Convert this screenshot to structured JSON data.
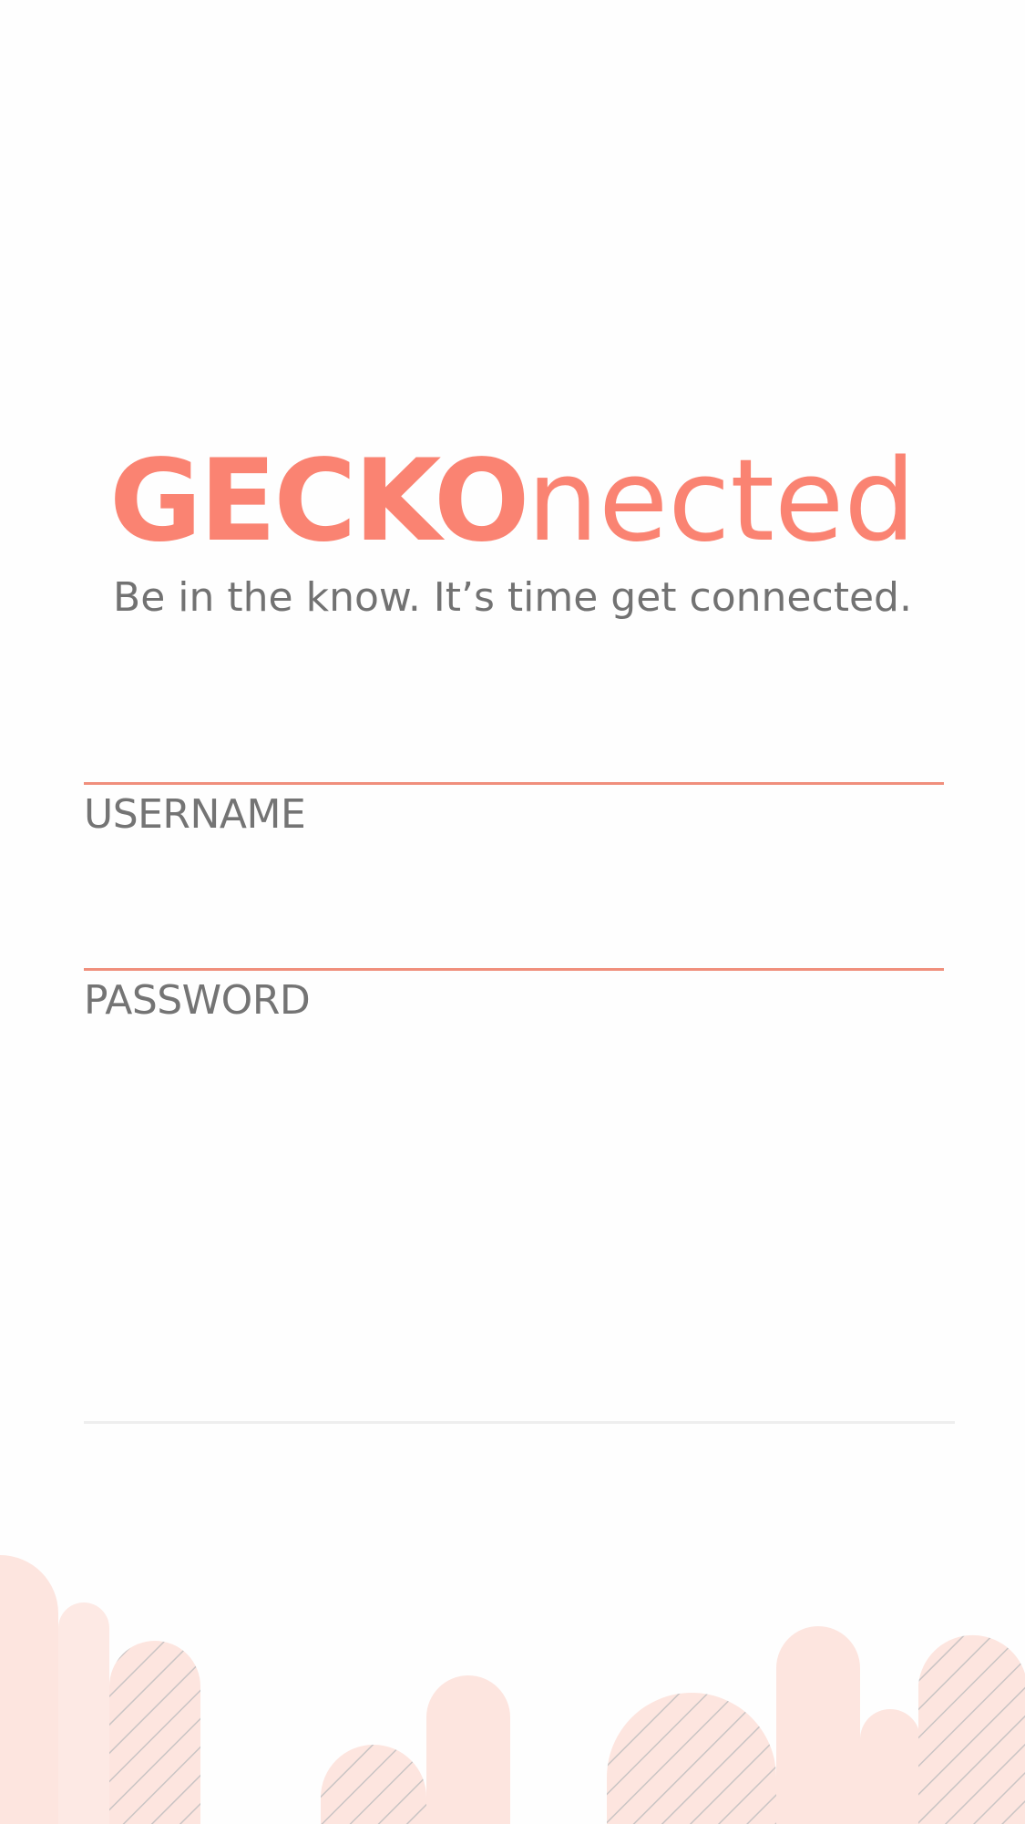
{
  "app": {
    "brand_bold": "GECKO",
    "brand_light": "nected",
    "tagline": "Be in the know. It’s time get connected."
  },
  "form": {
    "username_label": "USERNAME",
    "password_label": "PASSWORD",
    "username_value": "",
    "password_value": ""
  },
  "colors": {
    "accent": "#fa8372",
    "text_muted": "#747474",
    "decor_fill": "#fde5df",
    "decor_hatch": "#c9c4c4"
  }
}
